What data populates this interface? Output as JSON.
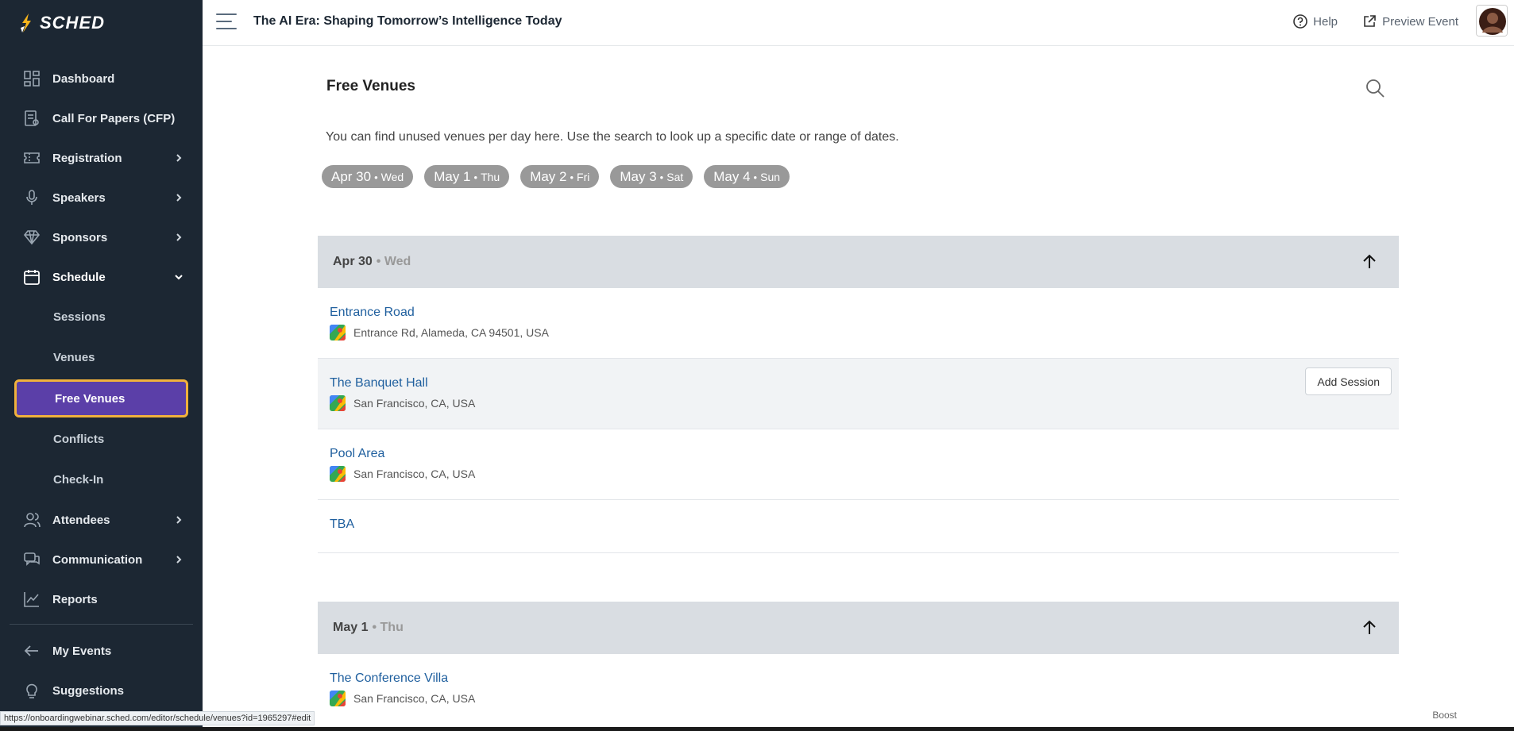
{
  "app": {
    "logo_text": "SCHED"
  },
  "header": {
    "event_title": "The AI Era: Shaping Tomorrow’s Intelligence Today",
    "help_label": "Help",
    "preview_label": "Preview Event"
  },
  "sidebar": {
    "items": [
      {
        "label": "Dashboard",
        "icon": "dashboard-icon",
        "has_chevron": false
      },
      {
        "label": "Call For Papers (CFP)",
        "icon": "cfp-icon",
        "has_chevron": false
      },
      {
        "label": "Registration",
        "icon": "ticket-icon",
        "has_chevron": true
      },
      {
        "label": "Speakers",
        "icon": "microphone-icon",
        "has_chevron": true
      },
      {
        "label": "Sponsors",
        "icon": "diamond-icon",
        "has_chevron": true
      },
      {
        "label": "Schedule",
        "icon": "calendar-icon",
        "has_chevron": true,
        "expanded": true
      }
    ],
    "schedule_sub": [
      {
        "label": "Sessions"
      },
      {
        "label": "Venues"
      },
      {
        "label": "Free Venues",
        "selected": true
      },
      {
        "label": "Conflicts"
      },
      {
        "label": "Check-In"
      }
    ],
    "items_after": [
      {
        "label": "Attendees",
        "icon": "users-icon",
        "has_chevron": true
      },
      {
        "label": "Communication",
        "icon": "chat-icon",
        "has_chevron": true
      },
      {
        "label": "Reports",
        "icon": "chart-icon",
        "has_chevron": false
      }
    ],
    "footer": [
      {
        "label": "My Events",
        "icon": "arrow-left-icon"
      },
      {
        "label": "Suggestions",
        "icon": "lightbulb-icon"
      }
    ]
  },
  "main": {
    "title": "Free Venues",
    "intro": "You can find unused venues per day here. Use the search to look up a specific date or range of dates.",
    "chips": [
      {
        "date": "Apr 30",
        "dow": "Wed"
      },
      {
        "date": "May 1",
        "dow": "Thu"
      },
      {
        "date": "May 2",
        "dow": "Fri"
      },
      {
        "date": "May 3",
        "dow": "Sat"
      },
      {
        "date": "May 4",
        "dow": "Sun"
      }
    ],
    "sections": [
      {
        "date": "Apr 30",
        "dow": "• Wed",
        "venues": [
          {
            "name": "Entrance Road",
            "address": "Entrance Rd, Alameda, CA 94501, USA"
          },
          {
            "name": "The Banquet Hall",
            "address": "San Francisco, CA, USA",
            "add_session_label": "Add Session"
          },
          {
            "name": "Pool Area",
            "address": "San Francisco, CA, USA"
          },
          {
            "name": "TBA"
          }
        ]
      },
      {
        "date": "May 1",
        "dow": "• Thu",
        "venues": [
          {
            "name": "The Conference Villa",
            "address": "San Francisco, CA, USA"
          }
        ]
      }
    ]
  },
  "status_bar": {
    "url": "https://onboardingwebinar.sched.com/editor/schedule/venues?id=1965297#edit"
  },
  "boost_label": "Boost",
  "colors": {
    "sidebar_bg": "#1c2733",
    "selected_bg": "#5b3fa8",
    "selected_border": "#f1b13c",
    "link": "#1f5f9e",
    "chip_bg": "#999999"
  }
}
